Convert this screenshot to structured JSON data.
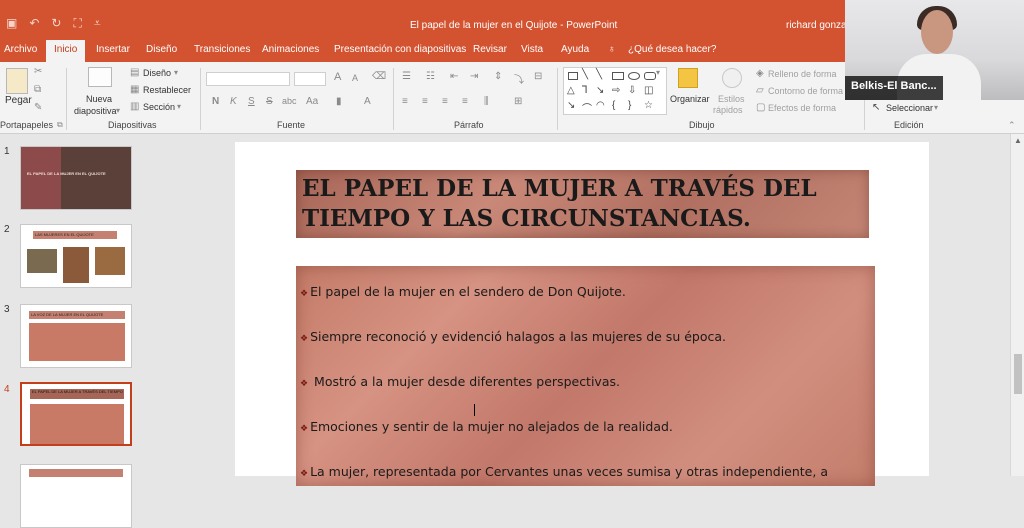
{
  "app": {
    "title": "El papel de la  mujer en el Quijote  -  PowerPoint",
    "user": "richard gonzale",
    "qat_icons": [
      "save-icon",
      "undo-icon",
      "redo-icon",
      "slideshow-icon",
      "customize-icon"
    ]
  },
  "tabs": [
    {
      "label": "Archivo"
    },
    {
      "label": "Inicio"
    },
    {
      "label": "Insertar"
    },
    {
      "label": "Diseño"
    },
    {
      "label": "Transiciones"
    },
    {
      "label": "Animaciones"
    },
    {
      "label": "Presentación con diapositivas"
    },
    {
      "label": "Revisar"
    },
    {
      "label": "Vista"
    },
    {
      "label": "Ayuda"
    },
    {
      "label": "¿Qué desea hacer?"
    }
  ],
  "ribbon": {
    "clipboard": {
      "paste": "Pegar",
      "label": "Portapapeles"
    },
    "slides": {
      "new_slide_1": "Nueva",
      "new_slide_2": "diapositiva",
      "layout": "Diseño",
      "reset": "Restablecer",
      "section": "Sección",
      "label": "Diapositivas"
    },
    "font": {
      "label": "Fuente",
      "bold": "N",
      "italic": "K",
      "underline": "S",
      "strike": "S",
      "charspacing": "abc",
      "grow": "A",
      "shrink": "A",
      "color": "A"
    },
    "paragraph": {
      "label": "Párrafo"
    },
    "drawing": {
      "label": "Dibujo",
      "arrange": "Organizar",
      "quick_styles_1": "Estilos",
      "quick_styles_2": "rápidos",
      "fill": "Relleno de forma",
      "outline": "Contorno de forma",
      "effects": "Efectos de forma"
    },
    "editing": {
      "label": "Edición",
      "select": "Seleccionar"
    }
  },
  "thumbnails": [
    {
      "number": "1",
      "title": "EL PAPEL DE LA MUJER EN EL QUIJOTE"
    },
    {
      "number": "2",
      "title": "LAS MUJERES EN EL QUIJOTE"
    },
    {
      "number": "3",
      "title": "LA VOZ DE LA MUJER EN EL QUIJOTE"
    },
    {
      "number": "4",
      "title": "EL PAPEL DE LA MUJER A TRAVÉS DEL TIEMPO"
    }
  ],
  "slide": {
    "title_line1": "EL PAPEL DE LA MUJER A TRAVÉS DEL",
    "title_line2": "TIEMPO Y LAS CIRCUNSTANCIAS.",
    "bullets": [
      "El papel de la mujer en el sendero de Don Quijote.",
      "Siempre reconoció y evidenció halagos a las mujeres de su época.",
      " Mostró a la mujer desde diferentes perspectivas.",
      "Emociones y sentir de la mujer no alejados de la realidad.",
      "La mujer, representada por Cervantes unas veces sumisa y otras independiente, a"
    ],
    "bullet_mark": "❖"
  },
  "video": {
    "name": "Belkis-El Banc..."
  }
}
